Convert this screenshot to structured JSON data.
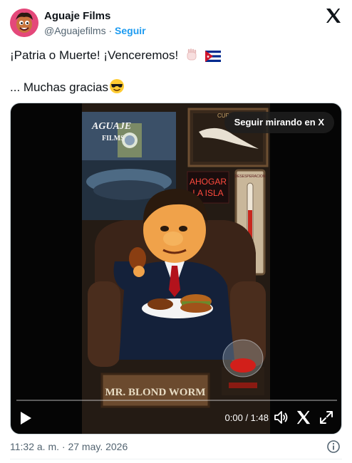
{
  "header": {
    "display_name": "Aguaje Films",
    "handle": "@Aguajefilms",
    "separator": "·",
    "follow_label": "Seguir",
    "logo_icon": "x-logo-icon"
  },
  "tweet": {
    "line1": "¡Patria o Muerte! ¡Venceremos!",
    "line2": "... Muchas gracias",
    "emojis": [
      "raised-fist-emoji",
      "cuba-flag-emoji",
      "sunglasses-emoji"
    ]
  },
  "media": {
    "cta_label": "Seguir mirando en X",
    "time": "0:00 / 1:48",
    "progress": 0,
    "controls": [
      "play-icon",
      "volume-icon",
      "x-logo-icon",
      "expand-icon"
    ],
    "video_texts": {
      "brand_top": "AGUAJE",
      "brand_bottom": "FILMS",
      "sign": "AHOGAR LA ISLA",
      "sign_line1": "AHOGAR",
      "sign_line2": "LA ISLA",
      "thermo": "DESESPERACION",
      "cup": "CUP",
      "nameplate": "MR. BLOND WORM"
    }
  },
  "footer": {
    "timestamp": "11:32 a. m. · 27 may. 2026",
    "info_icon": "info-icon"
  },
  "colors": {
    "text": "#0f1419",
    "muted": "#536471",
    "link": "#1d9bf0",
    "media_bg": "#050505"
  }
}
